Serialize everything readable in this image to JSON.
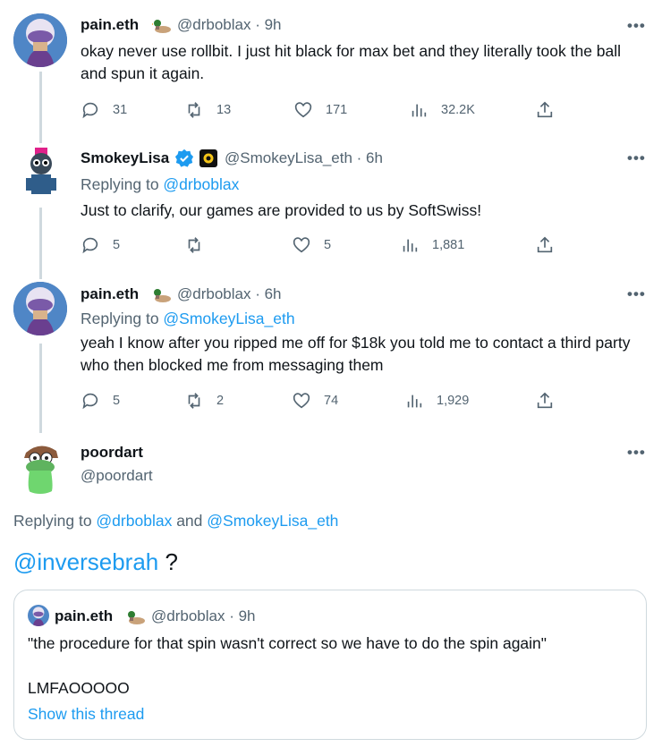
{
  "tweets": [
    {
      "name": "pain.eth",
      "handle": "@drboblax · 9h",
      "text": "okay never use rollbit. I just hit black for max bet and they literally took the ball and spun it again.",
      "replies": "31",
      "retweets": "13",
      "likes": "171",
      "views": "32.2K"
    },
    {
      "name": "SmokeyLisa",
      "handle": "@SmokeyLisa_eth · 6h",
      "replying_prefix": "Replying to ",
      "replying_to": "@drboblax",
      "text": "Just to clarify, our games are provided to us by SoftSwiss!",
      "replies": "5",
      "retweets": "",
      "likes": "5",
      "views": "1,881"
    },
    {
      "name": "pain.eth",
      "handle": "@drboblax · 6h",
      "replying_prefix": "Replying to ",
      "replying_to": "@SmokeyLisa_eth",
      "text": "yeah I know after you ripped me off for $18k you told me to contact a third party who then blocked me from messaging them",
      "replies": "5",
      "retweets": "2",
      "likes": "74",
      "views": "1,929"
    }
  ],
  "main_tweet": {
    "name": "poordart",
    "handle": "@poordart",
    "replying_prefix": "Replying to ",
    "replying_to_1": "@drboblax",
    "replying_and": " and ",
    "replying_to_2": "@SmokeyLisa_eth",
    "mention": "@inversebrah",
    "text_suffix": " ?"
  },
  "quote": {
    "name": "pain.eth",
    "handle": "@drboblax · 9h",
    "line1": "\"the procedure for that spin wasn't correct so we have to do the spin again\"",
    "line2": "LMFAOOOOO",
    "show_thread": "Show this thread"
  },
  "more_label": "•••",
  "colors": {
    "link": "#1d9bf0",
    "secondary_text": "#536471",
    "verified": "#1d9bf0",
    "thread_line": "#cfd9de"
  }
}
